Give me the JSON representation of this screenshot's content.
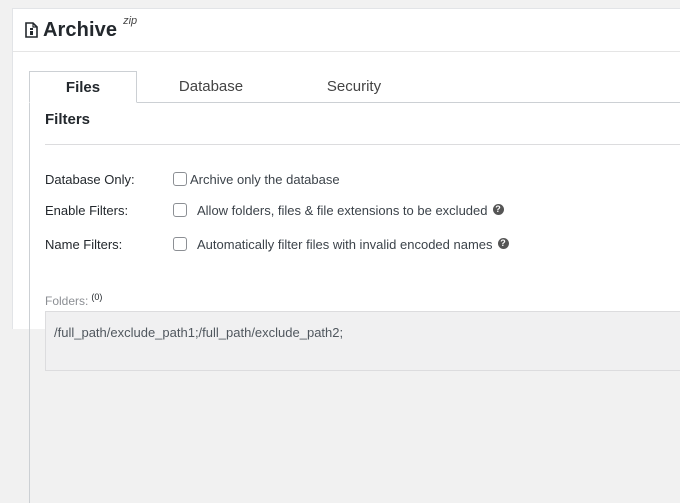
{
  "header": {
    "title": "Archive",
    "subtitle": "zip",
    "icon": "archive-file-icon"
  },
  "tabs": [
    {
      "label": "Files",
      "active": true
    },
    {
      "label": "Database",
      "active": false
    },
    {
      "label": "Security",
      "active": false
    }
  ],
  "filters": {
    "section_title": "Filters",
    "database_only": {
      "label": "Database Only:",
      "text": "Archive only the database",
      "checked": false
    },
    "enable_filters": {
      "label": "Enable Filters:",
      "text": "Allow folders, files & file extensions to be excluded",
      "checked": false,
      "help_icon": "help-icon"
    },
    "name_filters": {
      "label": "Name Filters:",
      "text": "Automatically filter files with invalid encoded names",
      "checked": false,
      "help_icon": "help-icon"
    },
    "folders": {
      "label": "Folders:",
      "count": "(0)",
      "value": "/full_path/exclude_path1;/full_path/exclude_path2;"
    }
  }
}
